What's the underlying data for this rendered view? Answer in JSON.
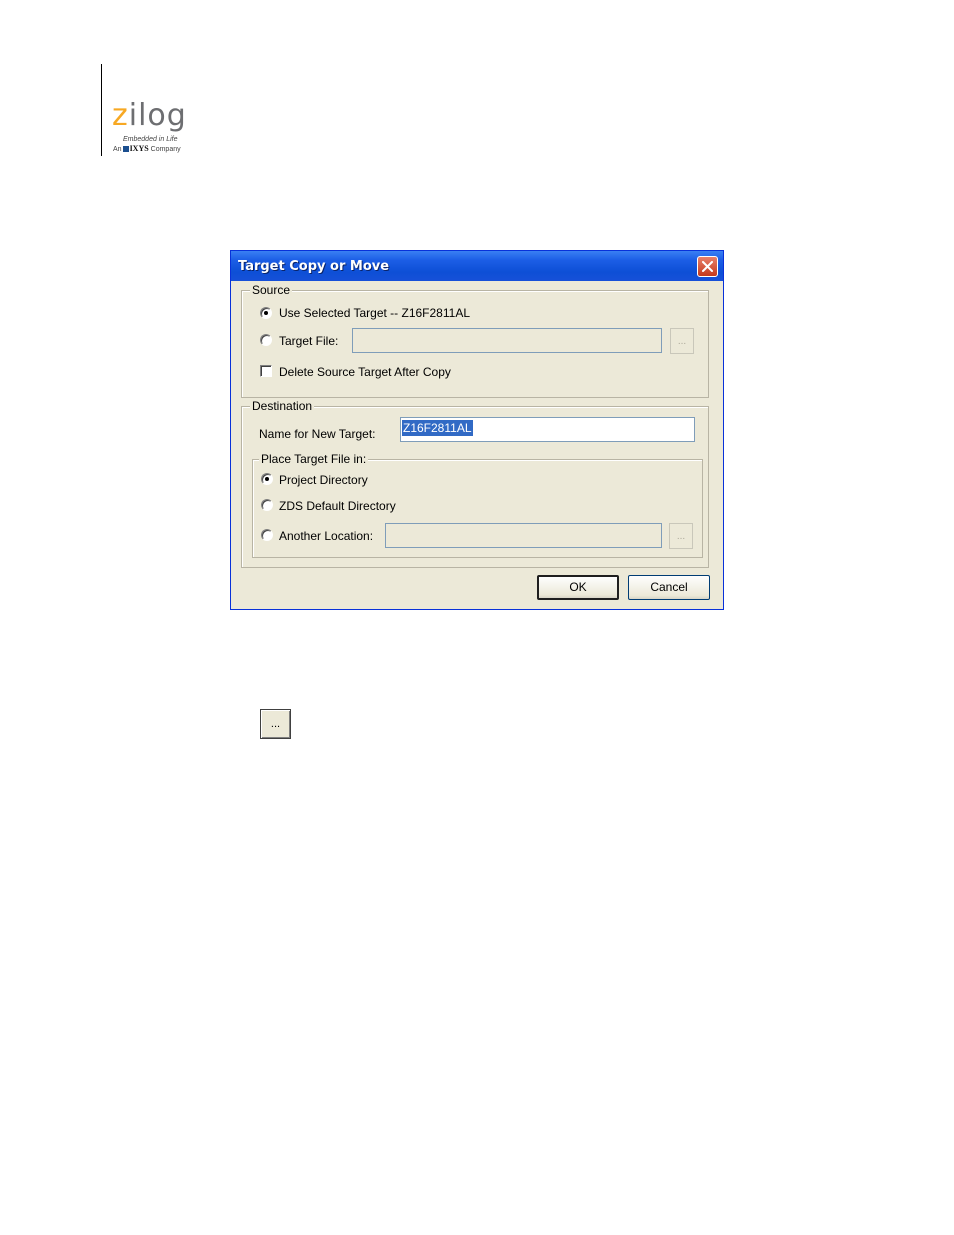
{
  "logo": {
    "word_accent": "z",
    "word_rest": "ilog",
    "tagline": "Embedded in Life",
    "company_prefix": "An",
    "company_brand": "IXYS",
    "company_suffix": "Company"
  },
  "dialog": {
    "title": "Target Copy or Move",
    "source": {
      "legend": "Source",
      "use_selected_label": "Use Selected Target -- Z16F2811AL",
      "use_selected_checked": true,
      "target_file_label": "Target File:",
      "target_file_checked": false,
      "target_file_value": "",
      "browse_label": "...",
      "delete_source_label": "Delete Source Target After Copy",
      "delete_source_checked": false
    },
    "destination": {
      "legend": "Destination",
      "name_label": "Name for New Target:",
      "name_value": "Z16F2811AL",
      "place": {
        "legend": "Place Target File in:",
        "project_dir_label": "Project Directory",
        "project_dir_checked": true,
        "zds_default_label": "ZDS Default Directory",
        "zds_default_checked": false,
        "another_location_label": "Another Location:",
        "another_location_checked": false,
        "another_location_value": "",
        "browse_label": "..."
      }
    },
    "ok_label": "OK",
    "cancel_label": "Cancel"
  },
  "standalone_browse_label": "..."
}
